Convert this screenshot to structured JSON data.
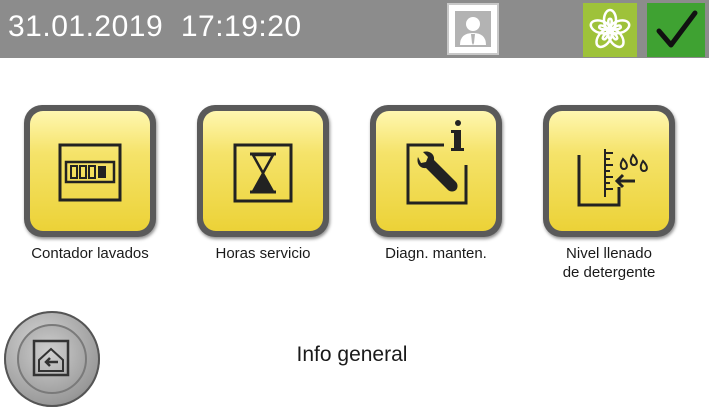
{
  "header": {
    "date": "31.01.2019",
    "time": "17:19:20"
  },
  "tiles": [
    {
      "label": "Contador lavados",
      "icon": "counter-icon"
    },
    {
      "label": "Horas servicio",
      "icon": "hourglass-icon"
    },
    {
      "label": "Diagn. manten.",
      "icon": "wrench-info-icon"
    },
    {
      "label": "Nivel llenado de detergente",
      "label_line1": "Nivel llenado",
      "label_line2": "de detergente",
      "icon": "detergent-level-icon"
    }
  ],
  "footer": {
    "title": "Info general"
  },
  "colors": {
    "topbar": "#8c8c8c",
    "tile_yellow": "#f5e36a",
    "flower_green": "#9ec23a",
    "check_green": "#3fa232"
  }
}
